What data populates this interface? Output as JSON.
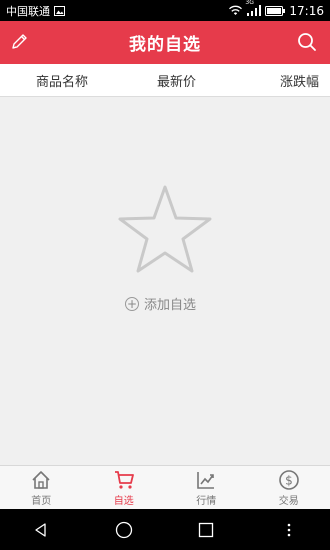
{
  "status_bar": {
    "carrier": "中国联通",
    "network_type": "3G",
    "time": "17:16"
  },
  "header": {
    "title": "我的自选"
  },
  "columns": {
    "name": "商品名称",
    "price": "最新价",
    "change": "涨跌幅"
  },
  "empty_state": {
    "add_label": "添加自选",
    "plus": "+"
  },
  "bottom_nav": [
    {
      "label": "首页",
      "icon": "home-icon",
      "active": false
    },
    {
      "label": "自选",
      "icon": "cart-icon",
      "active": true
    },
    {
      "label": "行情",
      "icon": "chart-icon",
      "active": false
    },
    {
      "label": "交易",
      "icon": "dollar-icon",
      "active": false
    }
  ],
  "colors": {
    "accent": "#e63b4b",
    "background": "#f0f0f0"
  }
}
